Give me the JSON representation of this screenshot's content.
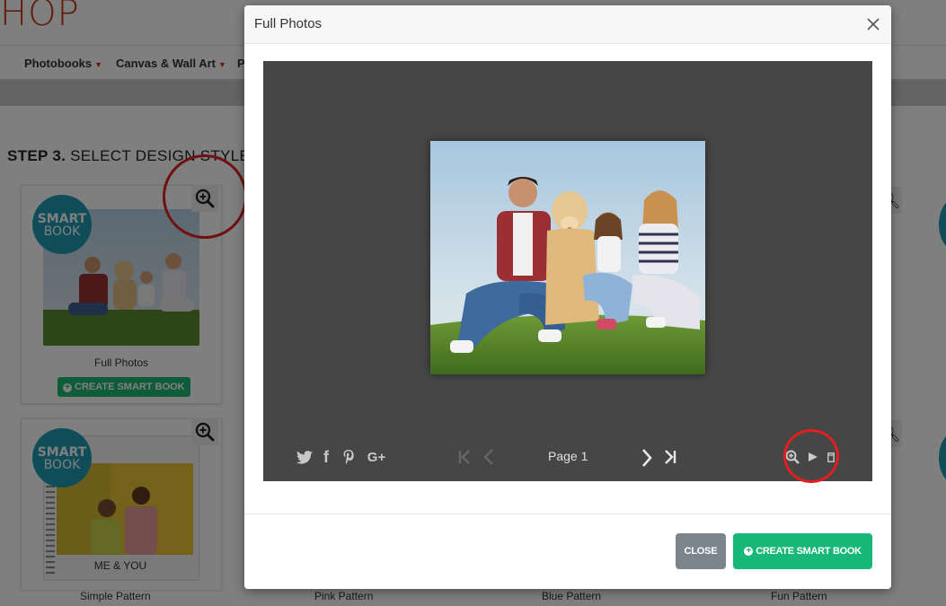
{
  "site": {
    "logo_text": "HOP"
  },
  "nav": {
    "items": [
      {
        "label": "Photobooks"
      },
      {
        "label": "Canvas & Wall Art"
      },
      {
        "label": "P"
      }
    ],
    "caret_icon": "chevron-down-icon"
  },
  "step": {
    "number": "STEP 3.",
    "text": "SELECT DESIGN STYLE"
  },
  "badge": {
    "line1": "SMART",
    "line2": "BOOK"
  },
  "cards": [
    {
      "title": "Full Photos",
      "button": "CREATE SMART BOOK"
    },
    {
      "title": "Simple Pattern",
      "cover_text": "ME & YOU"
    }
  ],
  "bottom_labels": [
    "Simple Pattern",
    "Pink Pattern",
    "Blue Pattern",
    "Fun Pattern"
  ],
  "modal": {
    "title": "Full Photos",
    "close_icon": "close-icon",
    "viewer": {
      "page_label": "Page 1",
      "share_icons": [
        "twitter-icon",
        "facebook-icon",
        "pinterest-icon",
        "google-plus-icon"
      ],
      "nav_icons": [
        "first-page-icon",
        "prev-page-icon",
        "next-page-icon",
        "last-page-icon"
      ],
      "tool_icons": [
        "zoom-icon",
        "play-icon",
        "fullscreen-icon"
      ]
    },
    "footer": {
      "close_label": "CLOSE",
      "create_label": "CREATE SMART BOOK"
    }
  },
  "colors": {
    "brand": "#c4391d",
    "teal": "#1f9bb3",
    "green": "#17b777",
    "gray_btn": "#7d858c",
    "viewer_bg": "#464646",
    "highlight_ring": "#e02020"
  }
}
